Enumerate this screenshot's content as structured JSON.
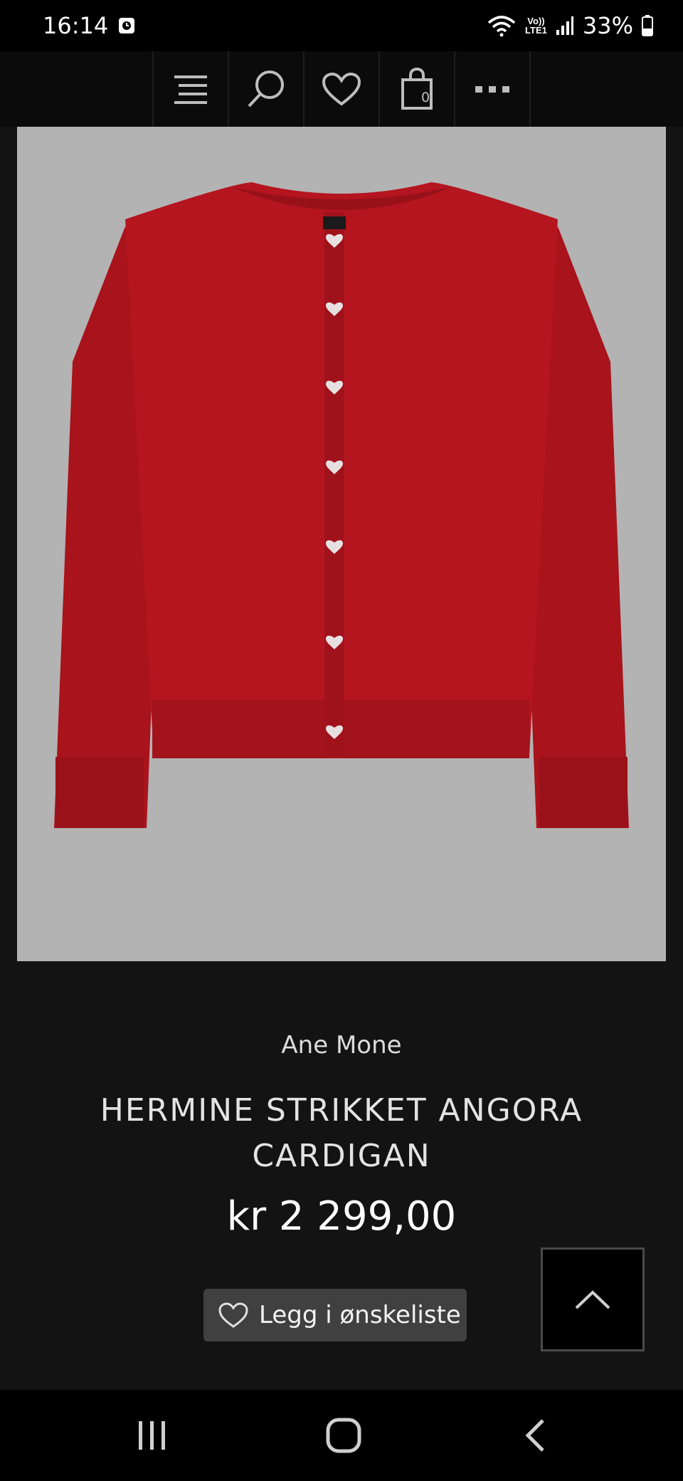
{
  "status_bar": {
    "time": "16:14",
    "battery": "33%",
    "network_badge_top": "Vo))",
    "network_badge_bottom": "LTE1"
  },
  "nav": {
    "cart_count": "0",
    "icons": [
      "menu-icon",
      "search-icon",
      "heart-icon",
      "shopping-bag-icon",
      "more-icon"
    ]
  },
  "product": {
    "brand": "Ane Mone",
    "title": "HERMINE STRIKKET ANGORA CARDIGAN",
    "price": "kr 2 299,00",
    "wishlist_label": "Legg i ønskeliste"
  },
  "colors": {
    "background": "#131313",
    "image_background": "#b3b3b3",
    "cardigan_red": "#b5151f",
    "button_gray": "#404040"
  }
}
